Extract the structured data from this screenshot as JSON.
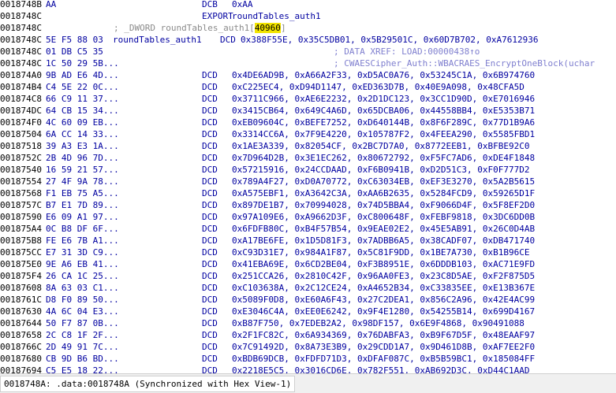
{
  "listing": [
    {
      "a": "0018748B",
      "b": "AA",
      "l": "",
      "m": "DCB",
      "o": "0xAA"
    },
    {
      "a": "0018748C",
      "b": "",
      "l": "",
      "m": "EXPORT",
      "o": "roundTables_auth1"
    },
    {
      "a": "0018748C",
      "kind": "comment",
      "c_pre": "; _DWORD roundTables_auth1[",
      "c_hl": "40960",
      "c_post": "]"
    },
    {
      "a": "0018748C",
      "b": "5E F5 88 03",
      "l": "roundTables_auth1",
      "m": "DCD",
      "o": "0x388F55E, 0x35C5DB01, 0x5B29501C, 0x60D7B702, 0xA7612936"
    },
    {
      "a": "0018748C",
      "b": "01 DB C5 35",
      "kind": "xref",
      "x": "; DATA XREF: LOAD:00000438↑o"
    },
    {
      "a": "0018748C",
      "b": "1C 50 29 5B...",
      "kind": "xref",
      "x": "; CWAESCipher_Auth::WBACRAES_EncryptOneBlock(uchar"
    },
    {
      "a": "001874A0",
      "b": "9B AD E6 4D...",
      "l": "",
      "m": "DCD",
      "o": "0x4DE6AD9B, 0xA66A2F33, 0xD5AC0A76, 0x53245C1A, 0x6B974760"
    },
    {
      "a": "001874B4",
      "b": "C4 5E 22 0C...",
      "l": "",
      "m": "DCD",
      "o": "0xC225EC4, 0xD94D1147, 0xED363D7B, 0x40E9A098, 0x48CFA5D"
    },
    {
      "a": "001874C8",
      "b": "66 C9 11 37...",
      "l": "",
      "m": "DCD",
      "o": "0x3711C966, 0xAE6E2232, 0x2D1DC123, 0x3CC1D90D, 0xE7016946"
    },
    {
      "a": "001874DC",
      "b": "64 CB 15 34...",
      "l": "",
      "m": "DCD",
      "o": "0x3415CB64, 0x649C4A6D, 0x65DCBA06, 0x44558BB4, 0xE5353B71"
    },
    {
      "a": "001874F0",
      "b": "4C 60 09 EB...",
      "l": "",
      "m": "DCD",
      "o": "0xEB09604C, 0xBEFE7252, 0xD640144B, 0x8F6F289C, 0x77D1B9A6"
    },
    {
      "a": "00187504",
      "b": "6A CC 14 33...",
      "l": "",
      "m": "DCD",
      "o": "0x3314CC6A, 0x7F9E4220, 0x105787F2, 0x4FEEA290, 0x5585FBD1"
    },
    {
      "a": "00187518",
      "b": "39 A3 E3 1A...",
      "l": "",
      "m": "DCD",
      "o": "0x1AE3A339, 0x82054CF, 0x2BC7D7A0, 0x8772EEB1, 0xBFBE92C0"
    },
    {
      "a": "0018752C",
      "b": "2B 4D 96 7D...",
      "l": "",
      "m": "DCD",
      "o": "0x7D964D2B, 0x3E1EC262, 0x80672792, 0xF5FC7AD6, 0xDE4F1848"
    },
    {
      "a": "00187540",
      "b": "16 59 21 57...",
      "l": "",
      "m": "DCD",
      "o": "0x57215916, 0x24CCDAAD, 0xF6B0941B, 0xD2D51C3, 0xF0F777D2"
    },
    {
      "a": "00187554",
      "b": "27 4F 9A 78...",
      "l": "",
      "m": "DCD",
      "o": "0x789A4F27, 0xD0A70772, 0xC63034EB, 0xEF3E3270, 0x5A2B5615"
    },
    {
      "a": "00187568",
      "b": "F1 EB 75 A5...",
      "l": "",
      "m": "DCD",
      "o": "0xA575EBF1, 0xA3642C3A, 0xAA6B2635, 0x5284FCD9, 0x59265D1F"
    },
    {
      "a": "0018757C",
      "b": "B7 E1 7D 89...",
      "l": "",
      "m": "DCD",
      "o": "0x897DE1B7, 0x70994028, 0x74D5BBA4, 0xF9066D4F, 0x5F8EF2D0"
    },
    {
      "a": "00187590",
      "b": "E6 09 A1 97...",
      "l": "",
      "m": "DCD",
      "o": "0x97A109E6, 0xA9662D3F, 0xC800648F, 0xFEBF9818, 0x3DC6DD0B"
    },
    {
      "a": "001875A4",
      "b": "0C B8 DF 6F...",
      "l": "",
      "m": "DCD",
      "o": "0x6FDFB80C, 0xB4F57B54, 0x9EAE02E2, 0x45E5AB91, 0x26C0D4AB"
    },
    {
      "a": "001875B8",
      "b": "FE E6 7B A1...",
      "l": "",
      "m": "DCD",
      "o": "0xA17BE6FE, 0x1D5D81F3, 0x7ADBB6A5, 0x38CADF07, 0xDB471740"
    },
    {
      "a": "001875CC",
      "b": "E7 31 3D C9...",
      "l": "",
      "m": "DCD",
      "o": "0xC93D31E7, 0x984A1F87, 0x5C81F9DD, 0x1BE7A730, 0xB1B96CE"
    },
    {
      "a": "001875E0",
      "b": "9E A6 EB 41...",
      "l": "",
      "m": "DCD",
      "o": "0x41EBA69E, 0x6CD2BE04, 0xF3B8951E, 0x6DDDB103, 0xAC71E9FD"
    },
    {
      "a": "001875F4",
      "b": "26 CA 1C 25...",
      "l": "",
      "m": "DCD",
      "o": "0x251CCA26, 0x2810C42F, 0x96AA0FE3, 0x23C8D5AE, 0xF2F875D5"
    },
    {
      "a": "00187608",
      "b": "8A 63 03 C1...",
      "l": "",
      "m": "DCD",
      "o": "0xC103638A, 0x2C12CE24, 0xA4652B34, 0xC33835EE, 0xE13B367E"
    },
    {
      "a": "0018761C",
      "b": "D8 F0 89 50...",
      "l": "",
      "m": "DCD",
      "o": "0x5089F0D8, 0xE60A6F43, 0x27C2DEA1, 0x856C2A96, 0x42E4AC99"
    },
    {
      "a": "00187630",
      "b": "4A 6C 04 E3...",
      "l": "",
      "m": "DCD",
      "o": "0xE3046C4A, 0xEE0E6242, 0x9F4E1280, 0x54255B14, 0x699D4167"
    },
    {
      "a": "00187644",
      "b": "50 F7 87 0B...",
      "l": "",
      "m": "DCD",
      "o": "0xB87F750, 0x7EDEB2A2, 0x98DF157, 0x6E9F4868, 0x90491088"
    },
    {
      "a": "00187658",
      "b": "2C C8 1F 2F...",
      "l": "",
      "m": "DCD",
      "o": "0x2F1FC82C, 0x6A934369, 0x76DABFA3, 0xB9F67D5F, 0x48EAAF97"
    },
    {
      "a": "0018766C",
      "b": "2D 49 91 7C...",
      "l": "",
      "m": "DCD",
      "o": "0x7C91492D, 0x8A73E3B9, 0x29CDD1A7, 0x9D461D8B, 0xAF7EE2F0"
    },
    {
      "a": "00187680",
      "b": "CB 9D B6 BD...",
      "l": "",
      "m": "DCD",
      "o": "0xBDB69DCB, 0xFDFD71D3, 0xDFAF087C, 0xB5B59BC1, 0x185084FF"
    },
    {
      "a": "00187694",
      "b": "C5 E5 18 22...",
      "l": "",
      "m": "DCD",
      "o": "0x2218E5C5, 0x3016CD6E, 0x782F551, 0xAB692D3C, 0xD44C1AAD"
    }
  ],
  "status": {
    "text": "0018748A: .data:0018748A (Synchronized with Hex View-1)"
  }
}
